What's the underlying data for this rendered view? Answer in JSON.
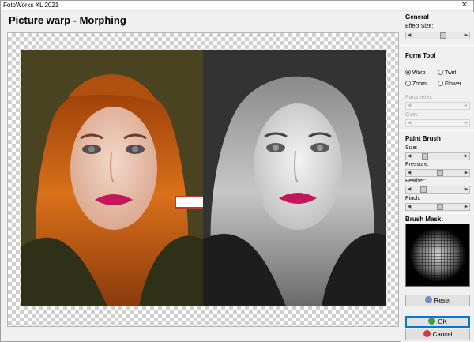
{
  "window": {
    "title": "FotoWorks XL 2021",
    "close_glyph": "✕"
  },
  "page": {
    "title": "Picture warp - Morphing"
  },
  "panel": {
    "general": {
      "title": "General",
      "effect_size_label": "Effect Size:",
      "effect_size_level": 0.62
    },
    "form_tool": {
      "title": "Form Tool",
      "options": [
        "Warp",
        "Twirl",
        "Zoom",
        "Flower"
      ],
      "selected": "Warp",
      "parameter_label": "Parameter:",
      "gain_label": "Gain:",
      "parameter_level": 0.0,
      "gain_level": 0.0
    },
    "paint_brush": {
      "title": "Paint Brush",
      "size_label": "Size:",
      "pressure_label": "Pressure:",
      "feather_label": "Feather:",
      "pinch_label": "Pinch:",
      "size_level": 0.22,
      "pressure_level": 0.55,
      "feather_level": 0.18,
      "pinch_level": 0.55
    },
    "brush_mask": {
      "title": "Brush Mask:"
    },
    "buttons": {
      "reset": "Reset",
      "ok": "OK",
      "cancel": "Cancel"
    }
  },
  "colors": {
    "accent": "#0078d7",
    "lips": "#c2185b",
    "hair": "#c8630f"
  },
  "icons": [
    "close-icon",
    "arrow-right-icon",
    "reset-icon",
    "ok-check-icon",
    "cancel-icon"
  ]
}
